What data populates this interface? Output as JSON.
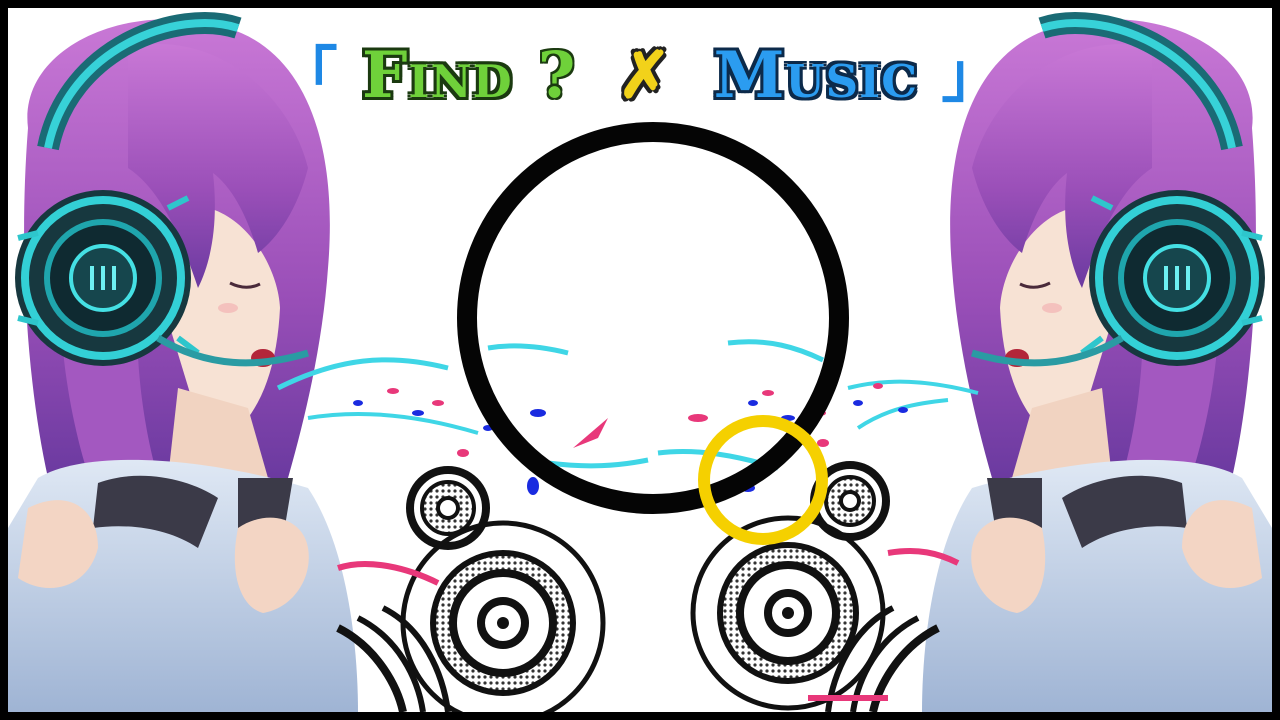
{
  "title": {
    "open_bracket": "「",
    "word1": "Find",
    "question": "?",
    "cross": "✗",
    "word2": "Music",
    "close_bracket": "」"
  },
  "colors": {
    "find_green": "#6fd13a",
    "cross_yellow": "#f2d21a",
    "music_blue": "#2b9cf0",
    "highlight_ring": "#f5d000",
    "hair_pink": "#b25fc4",
    "headphone_cyan": "#22c4c8",
    "splash_cyan": "#3fd6e6",
    "splash_pink": "#e8387a",
    "splash_blue": "#1a2be0"
  }
}
